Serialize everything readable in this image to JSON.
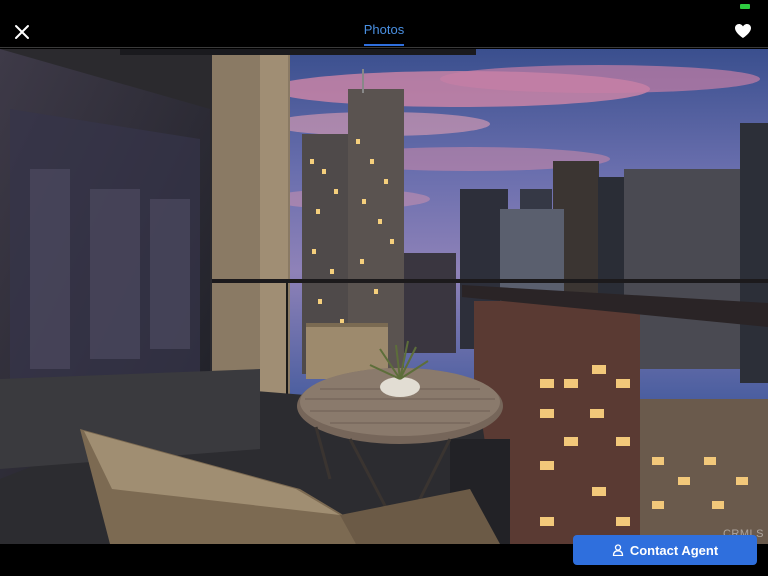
{
  "header": {
    "tab_label": "Photos"
  },
  "icons": {
    "close": "close-icon",
    "favorite": "heart-icon",
    "contact": "user-icon"
  },
  "photo": {
    "watermark": "CRMLS"
  },
  "footer": {
    "contact_label": "Contact Agent"
  },
  "colors": {
    "accent": "#2f6fdd",
    "tab_text": "#4a90e2",
    "battery": "#2ecc40"
  }
}
